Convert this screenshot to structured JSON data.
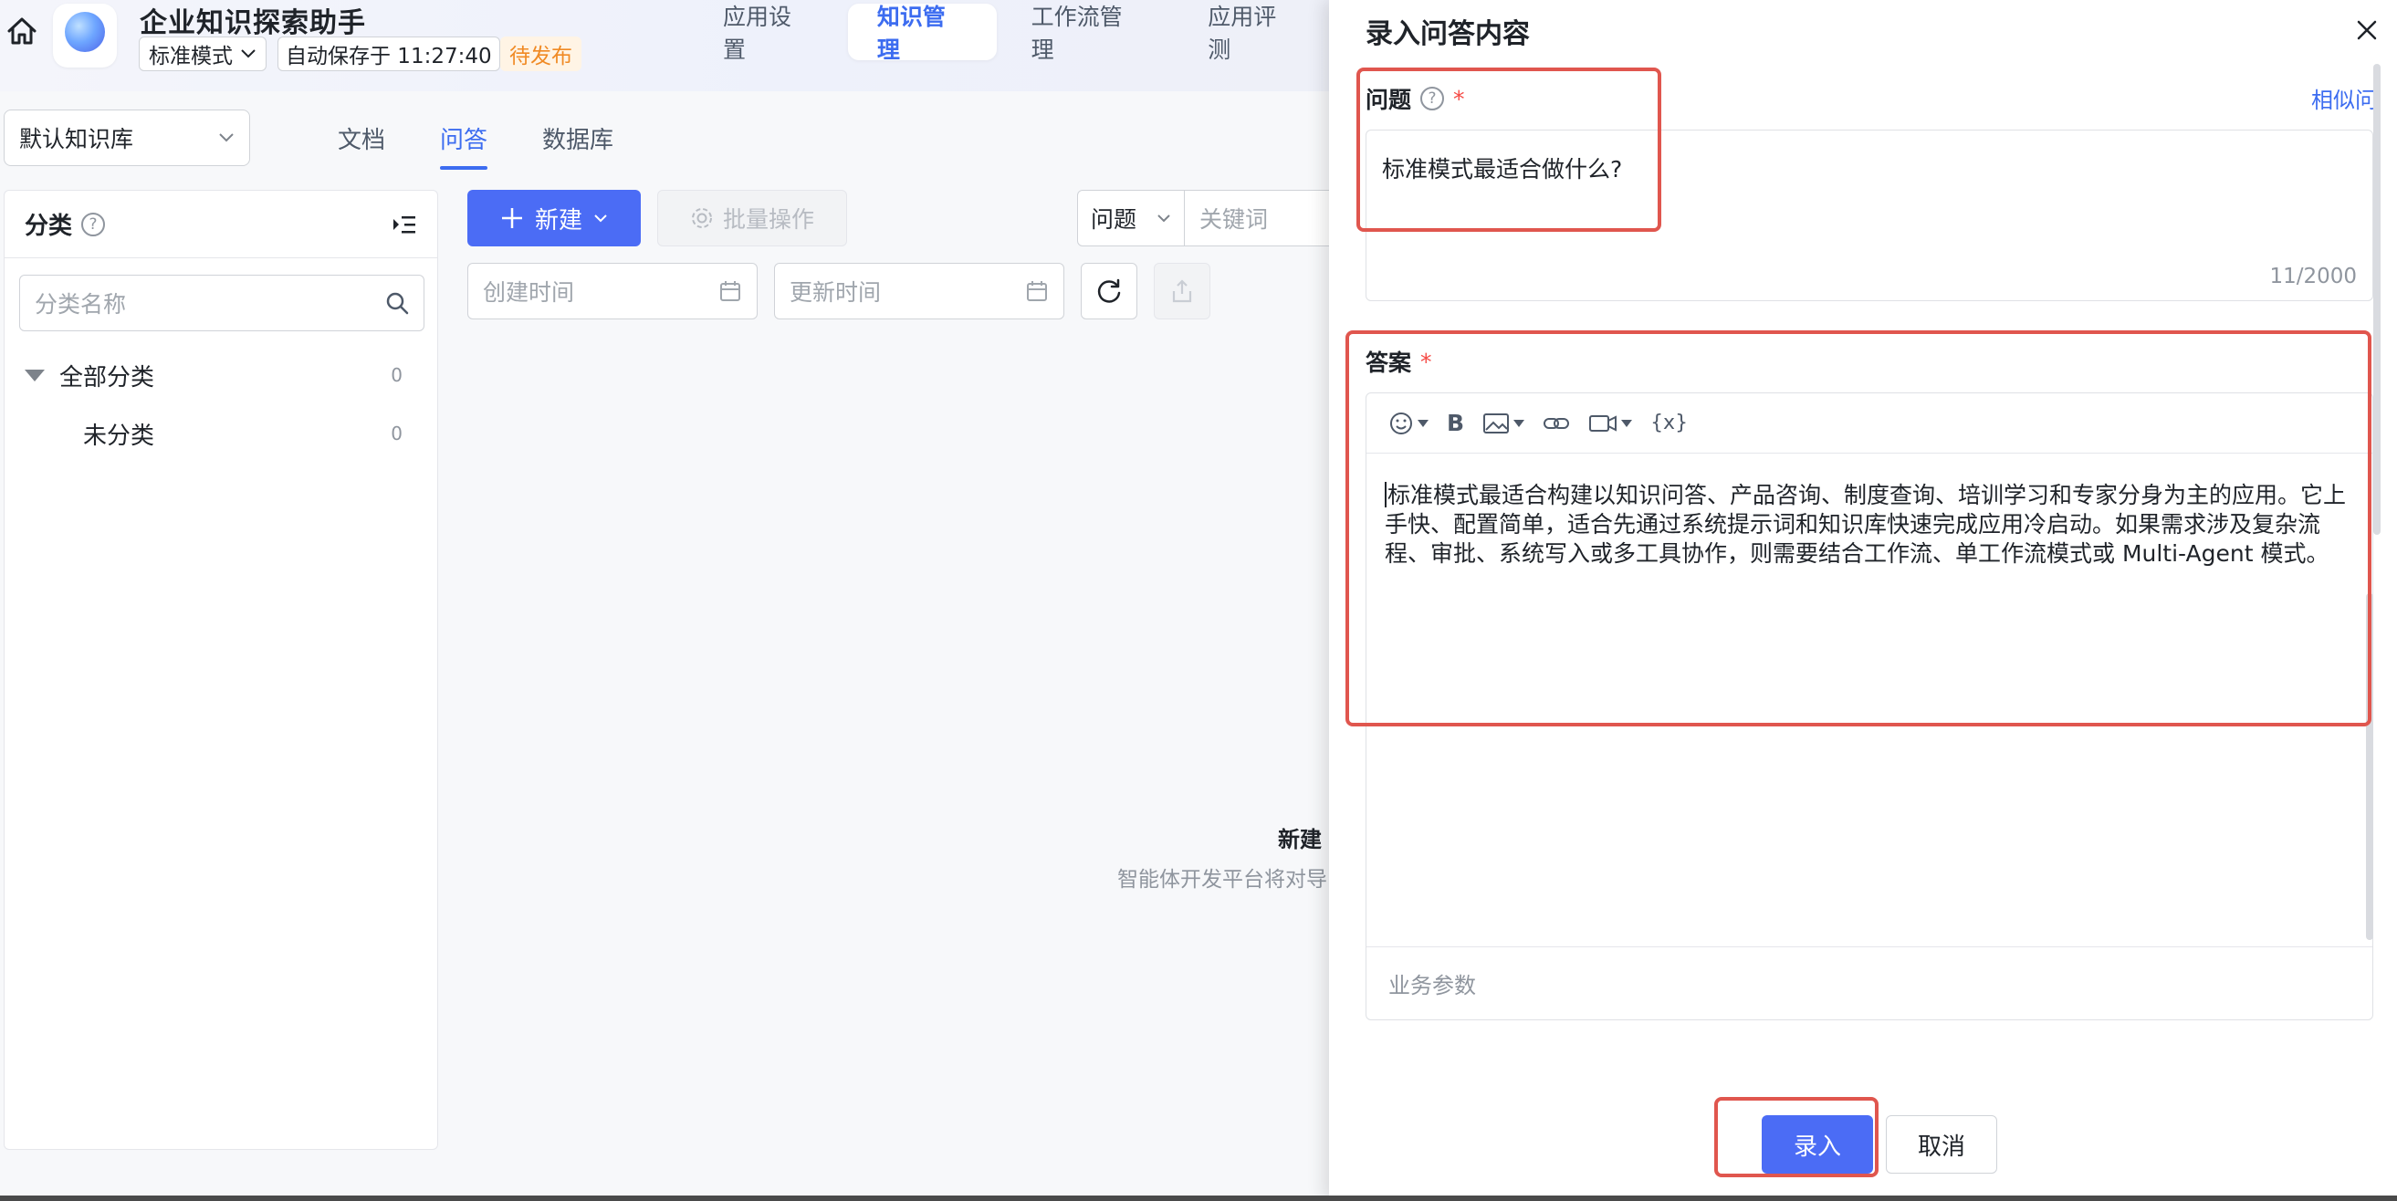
{
  "app": {
    "title": "企业知识探索助手",
    "mode": "标准模式",
    "autosave": "自动保存于 11:27:40",
    "status": "待发布",
    "tabs": [
      {
        "label": "应用设置"
      },
      {
        "label": "知识管理"
      },
      {
        "label": "工作流管理"
      },
      {
        "label": "应用评测"
      }
    ],
    "active_tab": "知识管理"
  },
  "knowledge": {
    "kb_select": "默认知识库",
    "sub_tabs": [
      {
        "label": "文档"
      },
      {
        "label": "问答"
      },
      {
        "label": "数据库"
      }
    ],
    "active_sub_tab": "问答"
  },
  "sidebar": {
    "title": "分类",
    "search_placeholder": "分类名称",
    "tree": [
      {
        "label": "全部分类",
        "count": "0"
      },
      {
        "label": "未分类",
        "count": "0"
      }
    ]
  },
  "toolbar": {
    "new_label": "新建",
    "batch_label": "批量操作",
    "filter_type": "问题",
    "keyword_placeholder": "关键词",
    "created_placeholder": "创建时间",
    "updated_placeholder": "更新时间"
  },
  "empty_state": {
    "title": "新建",
    "desc": "智能体开发平台将对导"
  },
  "drawer": {
    "title": "录入问答内容",
    "question_label": "问题",
    "similar_link": "相似问",
    "question_value": "标准模式最适合做什么?",
    "question_count": "11/2000",
    "answer_label": "答案",
    "answer_value": "标准模式最适合构建以知识问答、产品咨询、制度查询、培训学习和专家分身为主的应用。它上手快、配置简单，适合先通过系统提示词和知识库快速完成应用冷启动。如果需求涉及复杂流程、审批、系统写入或多工具协作，则需要结合工作流、单工作流模式或 Multi-Agent 模式。",
    "variable_label": "{x}",
    "bold_label": "B",
    "params_placeholder": "业务参数",
    "submit_label": "录入",
    "cancel_label": "取消"
  },
  "colors": {
    "primary": "#4b6cf5",
    "link": "#3c6cf0",
    "pending": "#f08a24",
    "required": "#f54a45",
    "annotation": "#e0564e"
  }
}
